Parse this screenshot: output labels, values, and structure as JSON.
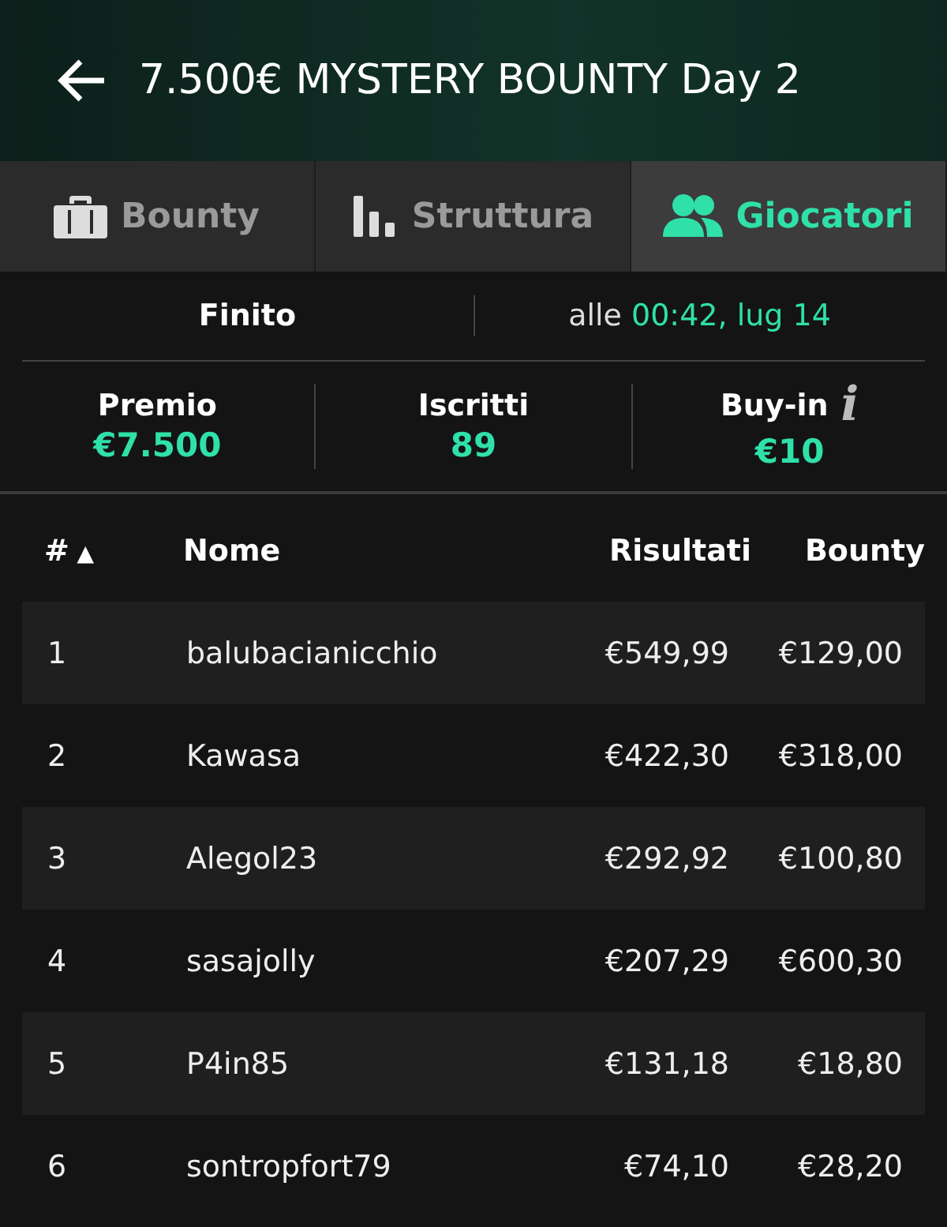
{
  "header": {
    "title": "7.500€ MYSTERY BOUNTY Day 2"
  },
  "tabs": [
    {
      "label": "Bounty",
      "selected": false
    },
    {
      "label": "Struttura",
      "selected": false
    },
    {
      "label": "Giocatori",
      "selected": true
    }
  ],
  "status": {
    "state": "Finito",
    "time_prefix": "alle ",
    "time": "00:42, lug 14"
  },
  "stats": [
    {
      "label": "Premio",
      "value": "€7.500"
    },
    {
      "label": "Iscritti",
      "value": "89"
    },
    {
      "label": "Buy-in",
      "value": "€10",
      "info": "i"
    }
  ],
  "table": {
    "columns": [
      {
        "label": "#",
        "sort": "▲"
      },
      {
        "label": "Nome"
      },
      {
        "label": "Risultati"
      },
      {
        "label": "Bounty"
      }
    ],
    "rows": [
      [
        "1",
        "balubacianicchio",
        "€549,99",
        "€129,00"
      ],
      [
        "2",
        "Kawasa",
        "€422,30",
        "€318,00"
      ],
      [
        "3",
        "Alegol23",
        "€292,92",
        "€100,80"
      ],
      [
        "4",
        "sasajolly",
        "€207,29",
        "€600,30"
      ],
      [
        "5",
        "P4in85",
        "€131,18",
        "€18,80"
      ],
      [
        "6",
        "sontropfort79",
        "€74,10",
        "€28,20"
      ]
    ]
  }
}
